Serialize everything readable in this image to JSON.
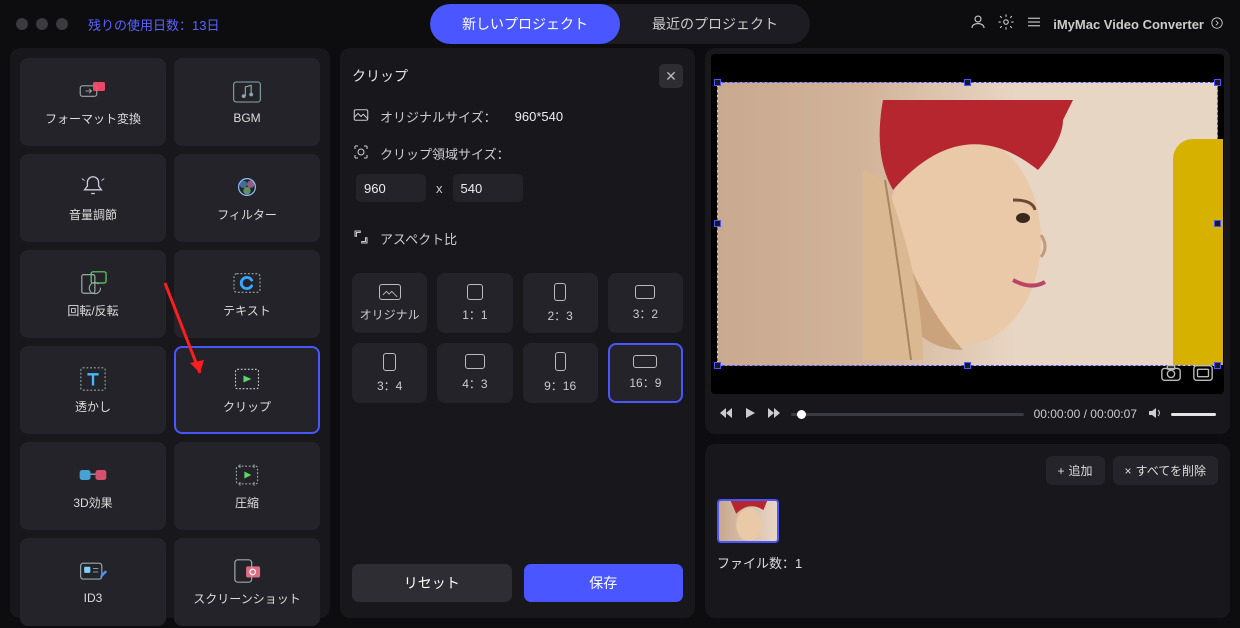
{
  "topbar": {
    "trial_text": "残りの使用日数：13日",
    "tabs": {
      "new_project": "新しいプロジェクト",
      "recent_project": "最近のプロジェクト"
    },
    "app_name": "iMyMac Video Converter"
  },
  "tools": {
    "format": "フォーマット変換",
    "bgm": "BGM",
    "volume": "音量調節",
    "filter": "フィルター",
    "rotate": "回転/反転",
    "text": "テキスト",
    "watermark": "透かし",
    "clip": "クリップ",
    "effect3d": "3D効果",
    "compress": "圧縮",
    "id3": "ID3",
    "screenshot": "スクリーンショット"
  },
  "clip_panel": {
    "title": "クリップ",
    "original_label": "オリジナルサイズ：",
    "original_value": "960*540",
    "region_label": "クリップ領域サイズ：",
    "width": "960",
    "height": "540",
    "x": "x",
    "aspect_label": "アスペクト比",
    "aspects": {
      "original": "オリジナル",
      "r1_1": "1：1",
      "r2_3": "2：3",
      "r3_2": "3：2",
      "r3_4": "3：4",
      "r4_3": "4：3",
      "r9_16": "9：16",
      "r16_9": "16：9"
    },
    "reset": "リセット",
    "save": "保存"
  },
  "player": {
    "time": "00:00:00 / 00:00:07"
  },
  "files": {
    "add": "追加",
    "delete_all": "すべてを削除",
    "count_label": "ファイル数：1"
  }
}
